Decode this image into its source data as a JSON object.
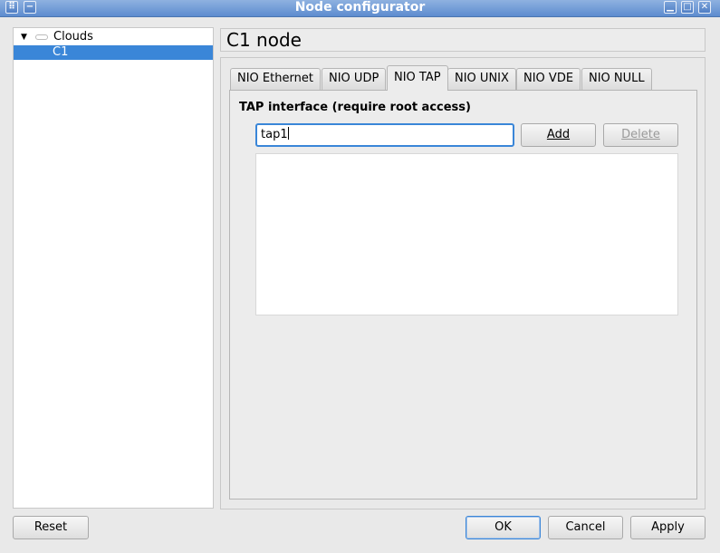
{
  "window": {
    "title": "Node configurator",
    "controls": [
      "menu-icon",
      "minimize-icon",
      "maximize-icon",
      "close-icon"
    ]
  },
  "tree": {
    "items": [
      {
        "label": "Clouds",
        "expanded": true,
        "icon": "folder-icon"
      },
      {
        "label": "C1",
        "selected": true
      }
    ]
  },
  "header": {
    "title": "C1 node"
  },
  "tabs": [
    {
      "label": "NIO Ethernet"
    },
    {
      "label": "NIO UDP"
    },
    {
      "label": "NIO TAP",
      "active": true
    },
    {
      "label": "NIO UNIX"
    },
    {
      "label": "NIO VDE"
    },
    {
      "label": "NIO NULL"
    }
  ],
  "tap": {
    "group_label": "TAP interface (require root access)",
    "input_value": "tap1",
    "add_label": "Add",
    "delete_label": "Delete",
    "list_items": []
  },
  "footer": {
    "reset_label": "Reset",
    "ok_label": "OK",
    "cancel_label": "Cancel",
    "apply_label": "Apply"
  },
  "colors": {
    "selection": "#3a86d8",
    "titlebar": "#6f9bd6"
  }
}
